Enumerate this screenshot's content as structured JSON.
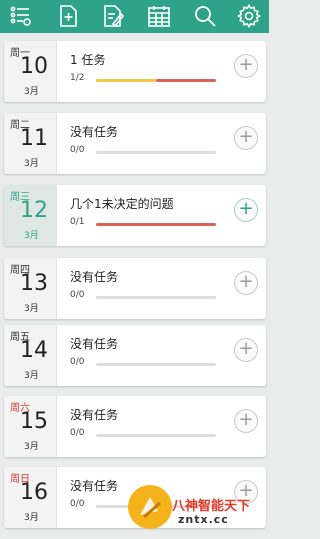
{
  "toolbar": {
    "color": "#2ea38a",
    "icons": [
      "list-settings-icon",
      "new-document-icon",
      "edit-document-icon",
      "calendar-icon",
      "search-icon",
      "gear-icon"
    ]
  },
  "rows": [
    {
      "weekday": "周一",
      "day": "10",
      "month": "3月",
      "title": "1 任务",
      "count": "1/2",
      "progress": 0.5,
      "highlight": false,
      "weekday_color": "default"
    },
    {
      "weekday": "周二",
      "day": "11",
      "month": "3月",
      "title": "没有任务",
      "count": "0/0",
      "progress": 0,
      "highlight": false,
      "weekday_color": "default"
    },
    {
      "weekday": "周三",
      "day": "12",
      "month": "3月",
      "title": "几个1未决定的问题",
      "count": "0/1",
      "progress": 0,
      "highlight": true,
      "weekday_color": "teal"
    },
    {
      "weekday": "周四",
      "day": "13",
      "month": "3月",
      "title": "没有任务",
      "count": "0/0",
      "progress": 0,
      "highlight": false,
      "weekday_color": "default"
    },
    {
      "weekday": "周五",
      "day": "14",
      "month": "3月",
      "title": "没有任务",
      "count": "0/0",
      "progress": 0,
      "highlight": false,
      "weekday_color": "default"
    },
    {
      "weekday": "周六",
      "day": "15",
      "month": "3月",
      "title": "没有任务",
      "count": "0/0",
      "progress": 0,
      "highlight": false,
      "weekday_color": "red"
    },
    {
      "weekday": "周日",
      "day": "16",
      "month": "3月",
      "title": "没有任务",
      "count": "0/0",
      "progress": 0,
      "highlight": false,
      "weekday_color": "red"
    }
  ],
  "add_label": "+",
  "colors": {
    "done": "#f2c84b",
    "pending": "#e0605a",
    "empty": "#dddddd",
    "accent": "#2ea38a",
    "weekend": "#d23b2f"
  },
  "watermark": {
    "line1": "八神智能天下",
    "line2": "zntx.cc"
  }
}
